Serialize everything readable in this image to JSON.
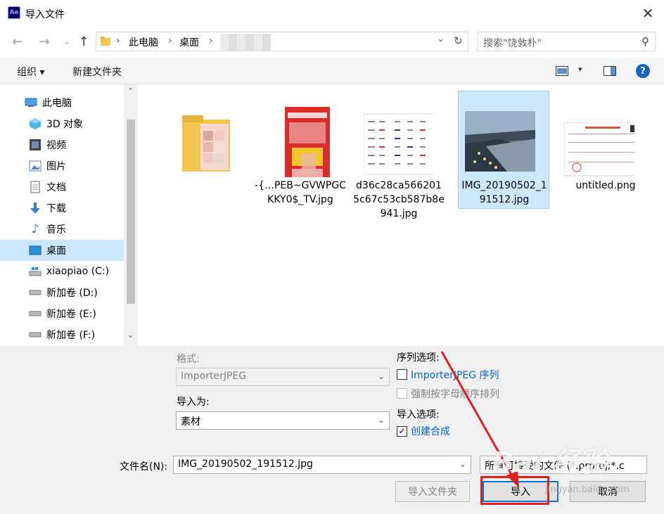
{
  "window": {
    "title": "导入文件",
    "app_icon": "Ae"
  },
  "breadcrumb": {
    "items": [
      "此电脑",
      "桌面"
    ],
    "separator": "›"
  },
  "search": {
    "placeholder": "搜索\"饶敦朴\""
  },
  "toolbar": {
    "organize_label": "组织 ▾",
    "new_folder_label": "新建文件夹"
  },
  "sidebar": {
    "items": [
      {
        "label": "此电脑",
        "icon": "computer-icon"
      },
      {
        "label": "3D 对象",
        "icon": "cube-icon"
      },
      {
        "label": "视频",
        "icon": "film-icon"
      },
      {
        "label": "图片",
        "icon": "picture-icon"
      },
      {
        "label": "文档",
        "icon": "document-icon"
      },
      {
        "label": "下载",
        "icon": "download-arrow-icon"
      },
      {
        "label": "音乐",
        "icon": "music-note-icon"
      },
      {
        "label": "桌面",
        "icon": "desktop-icon",
        "selected": true
      },
      {
        "label": "xiaopiao (C:)",
        "icon": "windows-drive-icon"
      },
      {
        "label": "新加卷 (D:)",
        "icon": "drive-icon"
      },
      {
        "label": "新加卷 (E:)",
        "icon": "drive-icon"
      },
      {
        "label": "新加卷 (F:)",
        "icon": "drive-icon"
      }
    ]
  },
  "files": [
    {
      "name": "",
      "type": "folder"
    },
    {
      "name": "-{…PEB~GVWPGCKKY0$_TV.jpg",
      "type": "image"
    },
    {
      "name": "d36c28ca5662015c67c53cb587b8e941.jpg",
      "type": "spreadsheet-image"
    },
    {
      "name": "IMG_20190502_191512.jpg",
      "type": "photo",
      "selected": true
    },
    {
      "name": "untitled.png",
      "type": "document-image"
    }
  ],
  "options": {
    "format_label": "格式:",
    "format_value": "ImporterJPEG",
    "import_as_label": "导入为:",
    "import_as_value": "素材",
    "sequence_options_label": "序列选项:",
    "sequence_checkbox_label": "ImporterJPEG 序列",
    "force_alpha_label": "强制按字母顺序排列",
    "import_options_label": "导入选项:",
    "create_comp_label": "创建合成",
    "create_comp_checked": "✓",
    "filename_label": "文件名(N):",
    "filename_value": "IMG_20190502_191512.jpg",
    "filetype_value": "所有可接受的文件 (*.prproj;*.c",
    "import_folder_button": "导入文件夹",
    "import_button": "导入",
    "cancel_button": "取消"
  },
  "watermark": {
    "text": "Bai 经验",
    "sub": "jingyan.baidu.com"
  },
  "colors": {
    "selected_bg": "#cce8ff",
    "highlight_red": "#e02020",
    "accent_blue": "#0078d7"
  }
}
